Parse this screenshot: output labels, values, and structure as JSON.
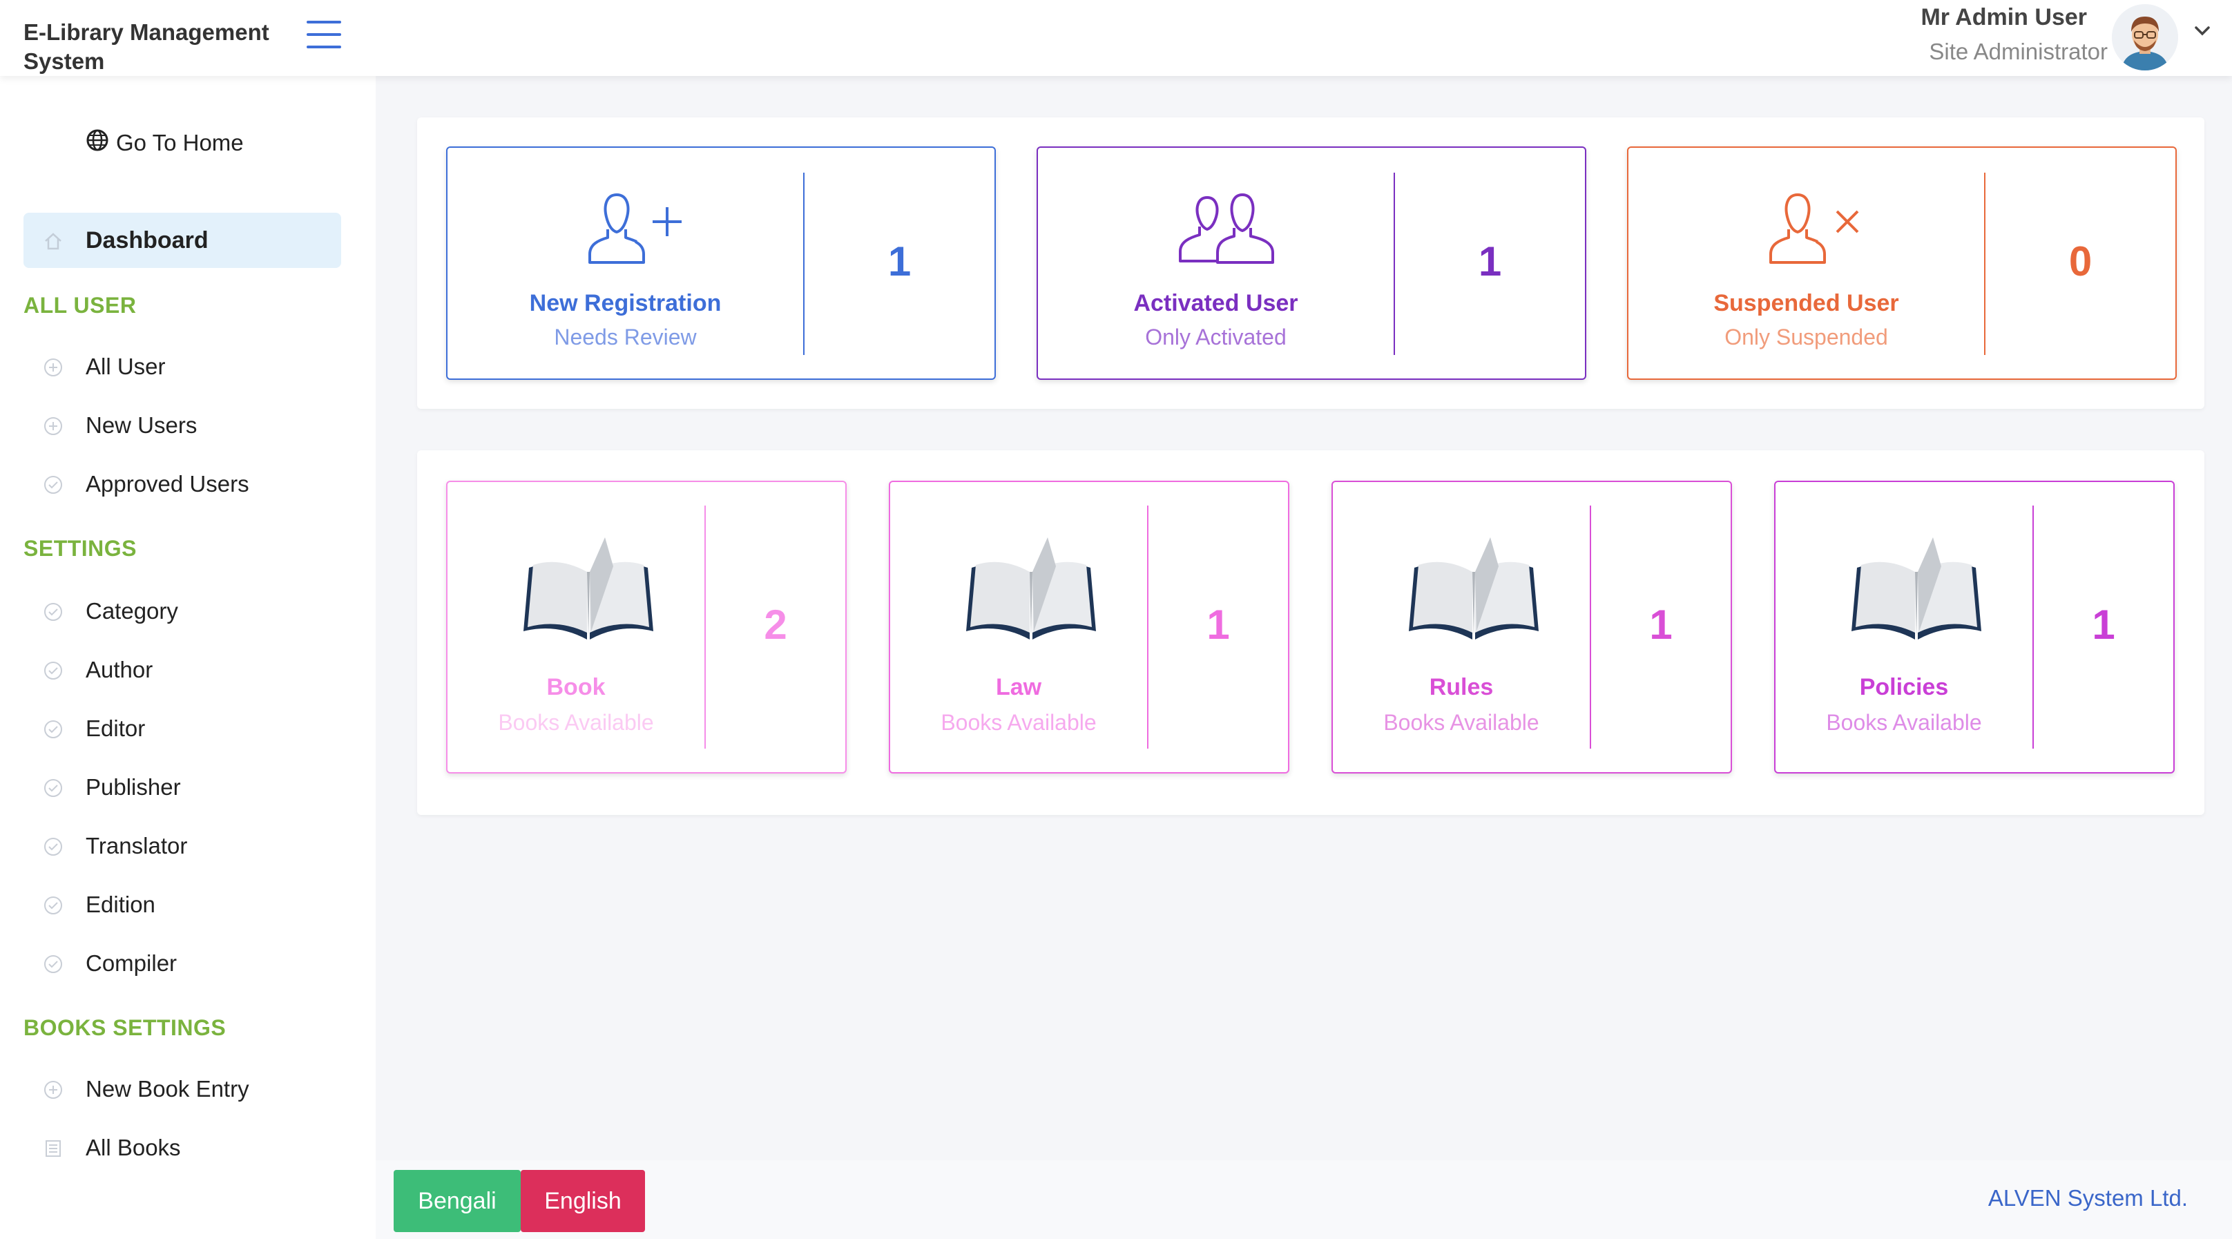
{
  "header": {
    "brand": "E-Library Management System",
    "user_name": "Mr Admin User",
    "user_role": "Site Administrator"
  },
  "sidebar": {
    "go_home": "Go To Home",
    "active_item": "Dashboard",
    "sections": [
      {
        "title": "ALL USER",
        "items": [
          {
            "label": "All User",
            "icon": "plus-circle-icon"
          },
          {
            "label": "New Users",
            "icon": "plus-circle-icon"
          },
          {
            "label": "Approved Users",
            "icon": "check-circle-icon"
          }
        ]
      },
      {
        "title": "SETTINGS",
        "items": [
          {
            "label": "Category",
            "icon": "check-circle-icon"
          },
          {
            "label": "Author",
            "icon": "check-circle-icon"
          },
          {
            "label": "Editor",
            "icon": "check-circle-icon"
          },
          {
            "label": "Publisher",
            "icon": "check-circle-icon"
          },
          {
            "label": "Translator",
            "icon": "check-circle-icon"
          },
          {
            "label": "Edition",
            "icon": "check-circle-icon"
          },
          {
            "label": "Compiler",
            "icon": "check-circle-icon"
          }
        ]
      },
      {
        "title": "BOOKS SETTINGS",
        "items": [
          {
            "label": "New Book Entry",
            "icon": "plus-circle-icon"
          },
          {
            "label": "All Books",
            "icon": "list-icon"
          }
        ]
      }
    ]
  },
  "user_cards": [
    {
      "title": "New Registration",
      "subtitle": "Needs Review",
      "count": "1",
      "icon": "user-plus-icon",
      "color": "#3d6ed8",
      "sub_color": "#7f9be6"
    },
    {
      "title": "Activated User",
      "subtitle": "Only Activated",
      "count": "1",
      "icon": "users-icon",
      "color": "#7a2fc0",
      "sub_color": "#a772d8"
    },
    {
      "title": "Suspended User",
      "subtitle": "Only Suspended",
      "count": "0",
      "icon": "user-x-icon",
      "color": "#e8683a",
      "sub_color": "#f19c7b"
    }
  ],
  "book_cards": [
    {
      "title": "Book",
      "subtitle": "Books Available",
      "count": "2",
      "icon": "open-book-icon",
      "color": "#f68ee8",
      "sub_color": "#fbcaf3"
    },
    {
      "title": "Law",
      "subtitle": "Books Available",
      "count": "1",
      "icon": "open-book-icon",
      "color": "#ef6ce0",
      "sub_color": "#f6a9ee"
    },
    {
      "title": "Rules",
      "subtitle": "Books Available",
      "count": "1",
      "icon": "open-book-icon",
      "color": "#d94fd6",
      "sub_color": "#e793e4"
    },
    {
      "title": "Policies",
      "subtitle": "Books Available",
      "count": "1",
      "icon": "open-book-icon",
      "color": "#c93fd6",
      "sub_color": "#de8ce7"
    }
  ],
  "footer": {
    "lang_bengali": "Bengali",
    "lang_english": "English",
    "bengali_color": "#3dbd78",
    "english_color": "#dc2f5b",
    "copyright": "ALVEN System Ltd."
  }
}
